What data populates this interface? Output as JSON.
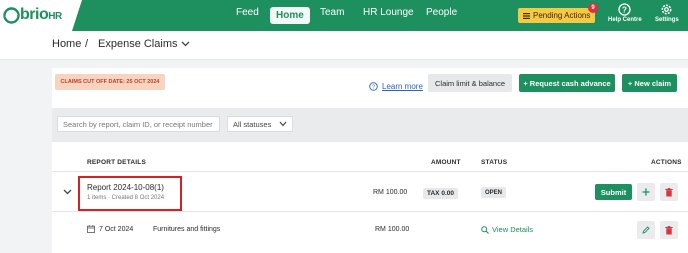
{
  "app": {
    "logo_text": "brio",
    "logo_suffix": "HR"
  },
  "nav": {
    "items": [
      "Feed",
      "Home",
      "Team",
      "HR Lounge",
      "People"
    ],
    "active": "Home",
    "pending_label": "Pending Actions",
    "pending_count": "9",
    "help_label": "Help Centre",
    "settings_label": "Settings"
  },
  "breadcrumb": {
    "home": "Home",
    "separator": "/",
    "current": "Expense Claims"
  },
  "toolbar": {
    "cutoff_label": "CLAIMS CUT OFF DATE: 25 OCT 2024",
    "learn_more": "Learn more",
    "claim_limit": "Claim limit & balance",
    "request_cash": "+ Request cash advance",
    "new_claim": "+ New claim"
  },
  "filters": {
    "search_placeholder": "Search by report, claim ID, or receipt number",
    "status_value": "All statuses"
  },
  "table": {
    "headers": {
      "report_details": "REPORT DETAILS",
      "amount": "AMOUNT",
      "status": "STATUS",
      "actions": "ACTIONS"
    },
    "report": {
      "title": "Report 2024-10-08(1)",
      "subtitle": "1 items · Created 8 Oct 2024",
      "amount": "RM 100.00",
      "tax": "TAX 0.00",
      "status": "OPEN",
      "submit_label": "Submit"
    },
    "item": {
      "date": "7 Oct 2024",
      "category": "Furnitures and fittings",
      "amount": "RM 100.00",
      "view_details": "View Details"
    }
  },
  "colors": {
    "brand": "#1e8f5f",
    "pending": "#f6c944",
    "highlight": "#d81f26",
    "danger": "#d6363f"
  }
}
